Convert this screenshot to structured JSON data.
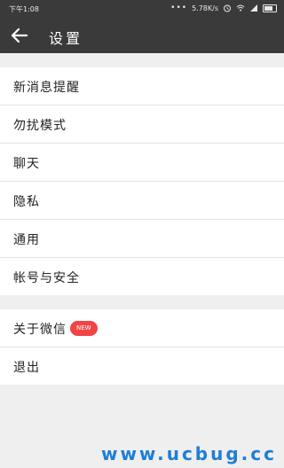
{
  "status_bar": {
    "time": "下午1:08",
    "speed": "5.78K/s"
  },
  "app_bar": {
    "title": "设置"
  },
  "settings_group_1": [
    {
      "label": "新消息提醒"
    },
    {
      "label": "勿扰模式"
    },
    {
      "label": "聊天"
    },
    {
      "label": "隐私"
    },
    {
      "label": "通用"
    },
    {
      "label": "帐号与安全"
    }
  ],
  "settings_group_2": {
    "about": {
      "label": "关于微信",
      "badge": "NEW"
    },
    "logout": {
      "label": "退出"
    }
  },
  "watermark": "www.ucbug.cc",
  "colors": {
    "app_bar": "#3a3a3a",
    "badge": "#f04545",
    "watermark": "#1d7ed6"
  }
}
